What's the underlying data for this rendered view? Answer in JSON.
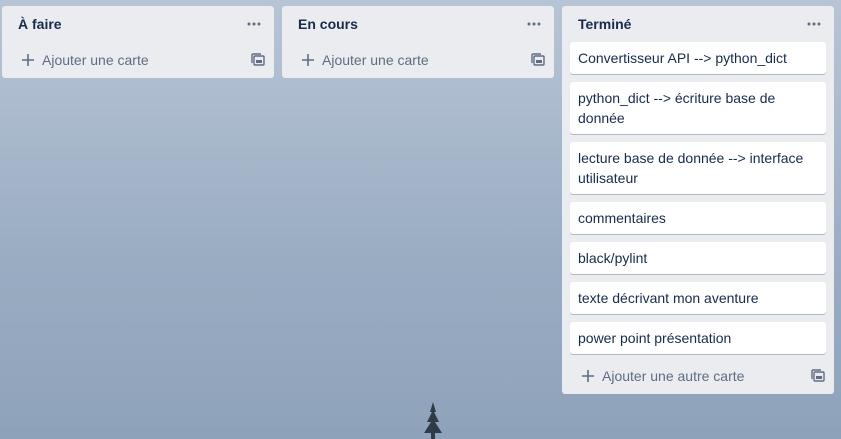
{
  "lists": [
    {
      "title": "À faire",
      "cards": [],
      "add_label": "Ajouter une carte"
    },
    {
      "title": "En cours",
      "cards": [],
      "add_label": "Ajouter une carte"
    },
    {
      "title": "Terminé",
      "cards": [
        "Convertisseur API --> python_dict",
        "python_dict --> écriture base de donnée",
        "lecture base de donnée --> interface utilisateur",
        "commentaires",
        "black/pylint",
        "texte décrivant mon aventure",
        "power point présentation"
      ],
      "add_label": "Ajouter une autre carte"
    }
  ],
  "icons": {
    "menu": "ellipsis-icon",
    "add": "plus-icon",
    "template": "card-template-icon"
  },
  "colors": {
    "list_bg": "#ebecf0",
    "card_bg": "#ffffff",
    "title_text": "#172b4d",
    "muted_text": "#5e6c84"
  }
}
